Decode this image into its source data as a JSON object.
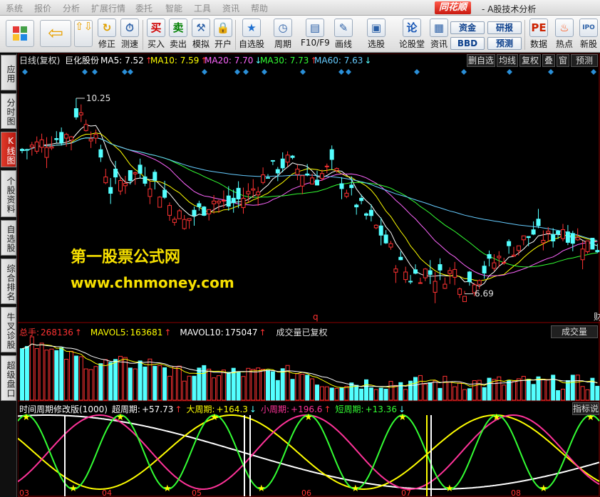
{
  "menubar": {
    "items": [
      "系统",
      "报价",
      "分析",
      "扩展行情",
      "委托",
      "智能",
      "工具",
      "资讯",
      "帮助"
    ],
    "logo": "同花顺",
    "window_title": "- A股技术分析"
  },
  "toolbar": {
    "buttons": [
      {
        "name": "restore-button",
        "label": "修正",
        "icon": "refresh-icon",
        "glyph": "↻"
      },
      {
        "name": "speed-test-button",
        "label": "测速",
        "icon": "clock-icon",
        "glyph": "⏱"
      },
      {
        "name": "buy-button",
        "label": "买入",
        "icon": "buy-icon",
        "glyph": "买"
      },
      {
        "name": "sell-button",
        "label": "卖出",
        "icon": "sell-icon",
        "glyph": "卖"
      },
      {
        "name": "simulate-button",
        "label": "模拟",
        "icon": "hammer-icon",
        "glyph": "⚒"
      },
      {
        "name": "open-account-button",
        "label": "开户",
        "icon": "lock-icon",
        "glyph": "🔒"
      },
      {
        "name": "watchlist-button",
        "label": "自选股",
        "icon": "star-icon",
        "glyph": "★"
      },
      {
        "name": "period-button",
        "label": "周期",
        "icon": "period-icon",
        "glyph": "◷"
      },
      {
        "name": "f10-button",
        "label": "F10/F9",
        "icon": "f10-icon",
        "glyph": "▤"
      },
      {
        "name": "draw-button",
        "label": "画线",
        "icon": "pen-icon",
        "glyph": "✎"
      },
      {
        "name": "select-stock-button",
        "label": "选股",
        "icon": "screen-icon",
        "glyph": "▣"
      },
      {
        "name": "forum-button",
        "label": "论股堂",
        "icon": "forum-icon",
        "glyph": "论"
      },
      {
        "name": "news-button",
        "label": "资讯",
        "icon": "news-icon",
        "glyph": "▦"
      },
      {
        "name": "data-button",
        "label": "数据",
        "icon": "pe-icon",
        "glyph": "PE"
      },
      {
        "name": "hot-button",
        "label": "热点",
        "icon": "fire-icon",
        "glyph": "♨"
      },
      {
        "name": "new-stock-button",
        "label": "新股",
        "icon": "newstock-icon",
        "glyph": "IPO"
      }
    ],
    "small_buttons": {
      "fund": "资金",
      "research": "研报",
      "bbd": "BBD",
      "forecast": "预测"
    }
  },
  "sidebar": {
    "tabs": [
      {
        "name": "sidebar-tab-apply",
        "label": "应用"
      },
      {
        "name": "sidebar-tab-timeshare",
        "label": "分时图"
      },
      {
        "name": "sidebar-tab-kline",
        "label": "K线图"
      },
      {
        "name": "sidebar-tab-profile",
        "label": "个股资料"
      },
      {
        "name": "sidebar-tab-watchlist",
        "label": "自选股"
      },
      {
        "name": "sidebar-tab-ranking",
        "label": "综合排名"
      },
      {
        "name": "sidebar-tab-diagnosis",
        "label": "牛叉诊股"
      },
      {
        "name": "sidebar-tab-superboard",
        "label": "超级盘口"
      }
    ]
  },
  "kline": {
    "period_label": "日线(复权)",
    "stock_name": "巨化股份",
    "ma": [
      {
        "name": "MA5",
        "value": "7.52",
        "dir": "up",
        "color": "#ffffff"
      },
      {
        "name": "MA10",
        "value": "7.59",
        "dir": "up",
        "color": "#ffff00"
      },
      {
        "name": "MA20",
        "value": "7.70",
        "dir": "down",
        "color": "#ff66ff"
      },
      {
        "name": "MA30",
        "value": "7.73",
        "dir": "up",
        "color": "#33ff33"
      },
      {
        "name": "MA60",
        "value": "7.63",
        "dir": "down",
        "color": "#66ccff"
      }
    ],
    "buttons": [
      "删自选",
      "均线",
      "复权",
      "叠",
      "窗",
      "预测"
    ],
    "high_label": "10.25",
    "low_label": "6.69",
    "q_label": "q",
    "edge_label": "财"
  },
  "volume": {
    "total_label": "总手:",
    "total_value": "268136",
    "mavol5_label": "MAVOL5:",
    "mavol5_value": "163681",
    "mavol10_label": "MAVOL10:",
    "mavol10_value": "175047",
    "note": "成交量已复权",
    "panel_button": "成交量"
  },
  "indicator": {
    "title": "时间周期修改版(1000)",
    "items": [
      {
        "label": "超周期:",
        "value": "+57.73",
        "dir": "up",
        "color": "#ffffff"
      },
      {
        "label": "大周期:",
        "value": "+164.3",
        "dir": "down",
        "color": "#ffff00"
      },
      {
        "label": "小周期:",
        "value": "+196.6",
        "dir": "up",
        "color": "#ff3399"
      },
      {
        "label": "短周期:",
        "value": "+13.36",
        "dir": "down",
        "color": "#33ff33"
      }
    ],
    "panel_button": "指标说",
    "month_labels": [
      "03",
      "04",
      "05",
      "06",
      "07",
      "08"
    ]
  },
  "watermark": {
    "line1": "第一股票公式网",
    "line2": "www.chnmoney.com"
  },
  "colors": {
    "up": "#ff3232",
    "down": "#54ffff",
    "background": "#000000"
  }
}
